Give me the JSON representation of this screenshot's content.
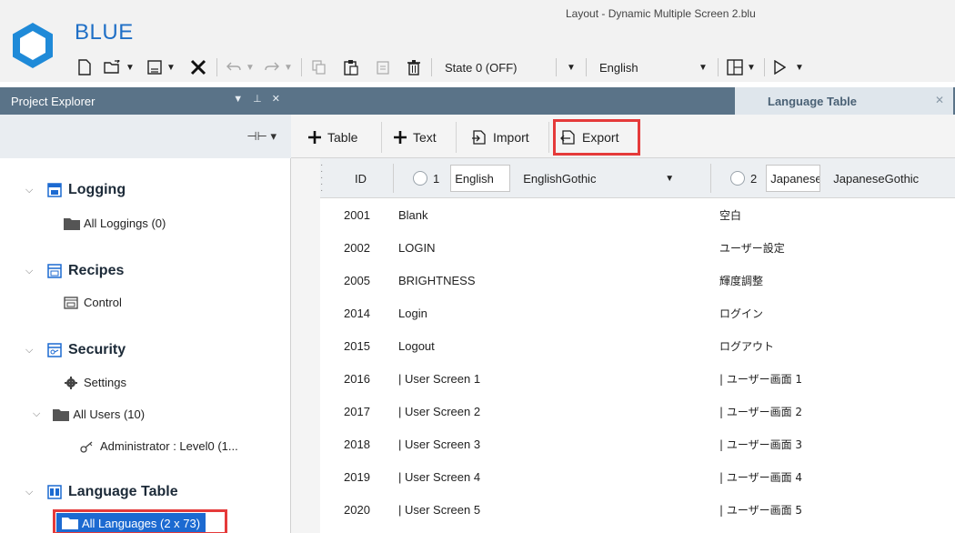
{
  "app": {
    "name": "BLUE",
    "window_title": "Layout - Dynamic Multiple Screen 2.blu"
  },
  "toolbar": {
    "icons": [
      "new-file-icon",
      "open-folder-icon",
      "save-icon",
      "close-x-icon",
      "undo-icon",
      "redo-icon",
      "copy-icon",
      "paste-icon",
      "paste-special-icon",
      "delete-icon",
      "layout-grid-icon",
      "run-play-icon"
    ],
    "state_combo": "State 0 (OFF)",
    "language_combo": "English"
  },
  "project_explorer": {
    "title": "Project Explorer",
    "groups": [
      {
        "label": "Logging",
        "icon": "logging-icon",
        "items": [
          {
            "label": "All Loggings (0)",
            "icon": "folder-icon"
          }
        ]
      },
      {
        "label": "Recipes",
        "icon": "recipes-icon",
        "items": [
          {
            "label": "Control",
            "icon": "recipe-item-icon"
          }
        ]
      },
      {
        "label": "Security",
        "icon": "security-icon",
        "items": [
          {
            "label": "Settings",
            "icon": "gear-icon"
          },
          {
            "label": "All Users (10)",
            "icon": "folder-icon"
          },
          {
            "label": "Administrator : Level0 (1...",
            "icon": "user-key-icon"
          }
        ]
      },
      {
        "label": "Language Table",
        "icon": "language-table-icon",
        "items": [
          {
            "label": "All Languages (2 x 73)",
            "icon": "folder-icon",
            "selected": true
          }
        ]
      }
    ]
  },
  "document": {
    "tab_title": "Language Table",
    "buttons": {
      "table": "Table",
      "text": "Text",
      "import": "Import",
      "export": "Export"
    },
    "header": {
      "id_label": "ID",
      "lang1": {
        "index": "1",
        "name": "English",
        "font": "EnglishGothic"
      },
      "lang2": {
        "index": "2",
        "name": "Japanese",
        "font": "JapaneseGothic"
      }
    },
    "rows": [
      {
        "id": "2001",
        "en": "Blank",
        "ja": "空白"
      },
      {
        "id": "2002",
        "en": "LOGIN",
        "ja": "ユーザー設定"
      },
      {
        "id": "2005",
        "en": "BRIGHTNESS",
        "ja": "輝度調整"
      },
      {
        "id": "2014",
        "en": "Login",
        "ja": "ログイン"
      },
      {
        "id": "2015",
        "en": "Logout",
        "ja": "ログアウト"
      },
      {
        "id": "2016",
        "en": "| User Screen 1",
        "ja": "| ユーザー画面 1"
      },
      {
        "id": "2017",
        "en": "| User Screen 2",
        "ja": "| ユーザー画面 2"
      },
      {
        "id": "2018",
        "en": "| User Screen 3",
        "ja": "| ユーザー画面 3"
      },
      {
        "id": "2019",
        "en": "| User Screen 4",
        "ja": "| ユーザー画面 4"
      },
      {
        "id": "2020",
        "en": "| User Screen 5",
        "ja": "| ユーザー画面 5"
      }
    ]
  },
  "colors": {
    "accent": "#1c6ad1",
    "panel_header": "#5a7388",
    "highlight": "#e53a3a"
  }
}
